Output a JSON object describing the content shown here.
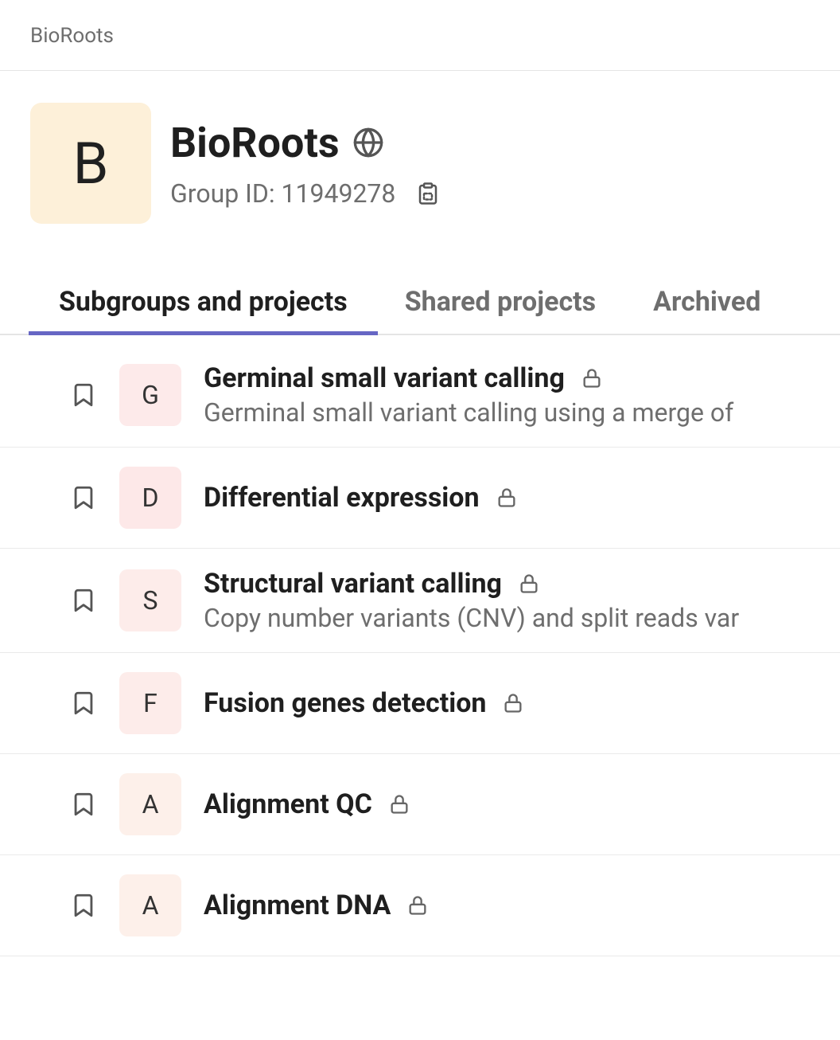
{
  "breadcrumb": "BioRoots",
  "group": {
    "avatar_letter": "B",
    "name": "BioRoots",
    "id_label": "Group ID: 11949278"
  },
  "tabs": [
    {
      "label": "Subgroups and projects",
      "active": true
    },
    {
      "label": "Shared projects",
      "active": false
    },
    {
      "label": "Archived",
      "active": false
    }
  ],
  "projects": [
    {
      "letter": "G",
      "bg": "#fdeaea",
      "title": "Germinal small variant calling",
      "desc": "Germinal small variant calling using a merge of "
    },
    {
      "letter": "D",
      "bg": "#fde8e8",
      "title": "Differential expression",
      "desc": ""
    },
    {
      "letter": "S",
      "bg": "#fdecea",
      "title": "Structural variant calling",
      "desc": "Copy number variants (CNV) and split reads var"
    },
    {
      "letter": "F",
      "bg": "#fdecea",
      "title": "Fusion genes detection",
      "desc": ""
    },
    {
      "letter": "A",
      "bg": "#fdf0ea",
      "title": "Alignment QC",
      "desc": ""
    },
    {
      "letter": "A",
      "bg": "#fdf0ea",
      "title": "Alignment DNA",
      "desc": ""
    }
  ]
}
